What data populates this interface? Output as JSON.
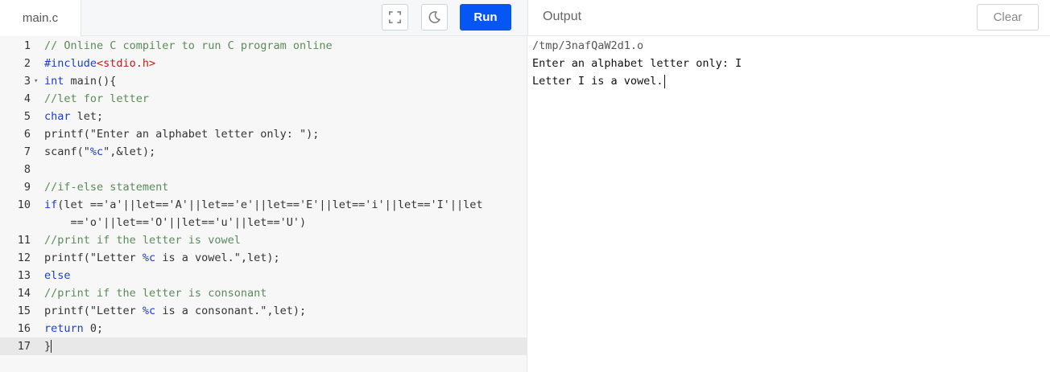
{
  "tab": {
    "filename": "main.c"
  },
  "toolbar": {
    "fullscreen_icon": "fullscreen-icon",
    "theme_icon": "moon-icon",
    "run_label": "Run"
  },
  "output_panel": {
    "title": "Output",
    "clear_label": "Clear",
    "lines": [
      "/tmp/3nafQaW2d1.o",
      "Enter an alphabet letter only: I",
      "Letter I is a vowel."
    ]
  },
  "editor": {
    "line_numbers": [
      "1",
      "2",
      "3",
      "4",
      "5",
      "6",
      "7",
      "8",
      "9",
      "10",
      "",
      "11",
      "12",
      "13",
      "14",
      "15",
      "16",
      "17"
    ],
    "lines": [
      "// Online C compiler to run C program online",
      "#include<stdio.h>",
      "int main(){",
      "//let for letter",
      "char let;",
      "printf(\"Enter an alphabet letter only: \");",
      "scanf(\"%c\",&let);",
      "",
      "//if-else statement",
      "if(let =='a'||let=='A'||let=='e'||let=='E'||let=='i'||let=='I'||let",
      "    =='o'||let=='O'||let=='u'||let=='U')",
      "//print if the letter is vowel",
      "printf(\"Letter %c is a vowel.\",let);",
      "else",
      "//print if the letter is consonant",
      "printf(\"Letter %c is a consonant.\",let);",
      "return 0;",
      "}"
    ]
  },
  "colors": {
    "run_button": "#0556f3",
    "comment": "#5b8a5b",
    "keyword": "#1a3fc2",
    "include_header": "#c41a16",
    "active_line": "#e8e8e8"
  }
}
